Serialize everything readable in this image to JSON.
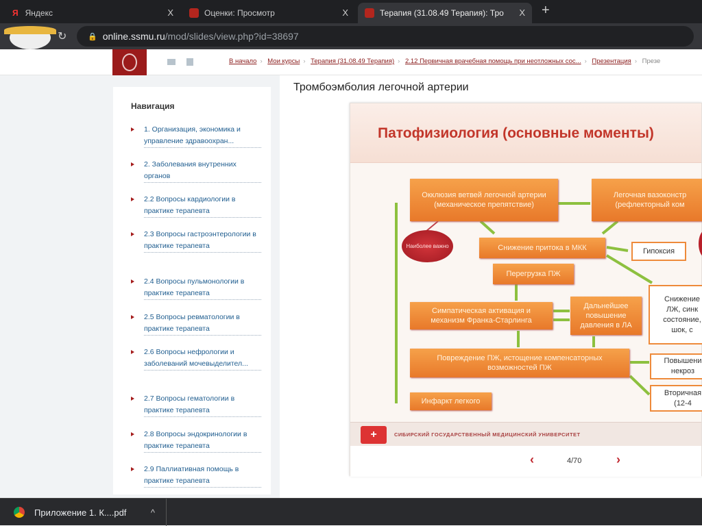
{
  "browser": {
    "tabs": [
      {
        "label": "Яндекс",
        "active": false
      },
      {
        "label": "Оценки: Просмотр",
        "active": false
      },
      {
        "label": "Терапия (31.08.49 Терапия): Тро",
        "active": true
      }
    ],
    "new_tab": "+",
    "close": "X",
    "url_host": "online.ssmu.ru",
    "url_path": "/mod/slides/view.php?id=38697"
  },
  "breadcrumb": [
    "В начало",
    "Мои курсы",
    "Терапия (31.08.49 Терапия)",
    "2.12 Первичная врачебная помощь при неотложных сос...",
    "Презентация",
    "Презе"
  ],
  "nav": {
    "title": "Навигация",
    "items": [
      "1. Организация, экономика и управление здравоохран...",
      "2. Заболевания внутренних органов",
      "2.2 Вопросы кардиологии в практике терапевта",
      "2.3 Вопросы гастроэнтерологии в практике терапевта",
      "2.4 Вопросы пульмонологии в практике терапевта",
      "2.5 Вопросы ревматологии в практике терапевта",
      "2.6 Вопросы нефрологии и заболеваний мочевыделител...",
      "2.7 Вопросы гематологии в практике терапевта",
      "2.8 Вопросы эндокринологии в практике терапевта",
      "2.9 Паллиативная помощь в практике терапевта"
    ]
  },
  "page_title": "Тромбоэмболия легочной артерии",
  "slide": {
    "title": "Патофизиология (основные моменты)",
    "boxes": {
      "occlusion": "Окклюзия ветвей легочной артерии (механическое препятствие)",
      "vasoconstriction": "Легочная вазоконстр (рефлекторный ком",
      "most_important": "Наиболее важно",
      "reduced_inflow": "Снижение притока в МКК",
      "hypoxia": "Гипоксия",
      "rv_overload": "Перегрузка ПЖ",
      "sympathetic": "Симпатическая активация и механизм Франка-Старлинга",
      "further_pressure": "Дальнейшее повышение давления в ЛА",
      "reduction_lv": "Снижение ЛЖ, синк состояние, шок, с",
      "rv_damage": "Повреждение ПЖ, истощение компенсаторных возможностей ПЖ",
      "increase_necrosis": "Повышени некроз",
      "lung_infarction": "Инфаркт легкого",
      "secondary": "Вторичная (12-4"
    },
    "footer": "СИБИРСКИЙ ГОСУДАРСТВЕННЫЙ МЕДИЦИНСКИЙ УНИВЕРСИТЕТ",
    "page": "4/70",
    "prev": "‹",
    "next": "›"
  },
  "download": {
    "file": "Приложение 1. К....pdf",
    "chevron": "^"
  }
}
